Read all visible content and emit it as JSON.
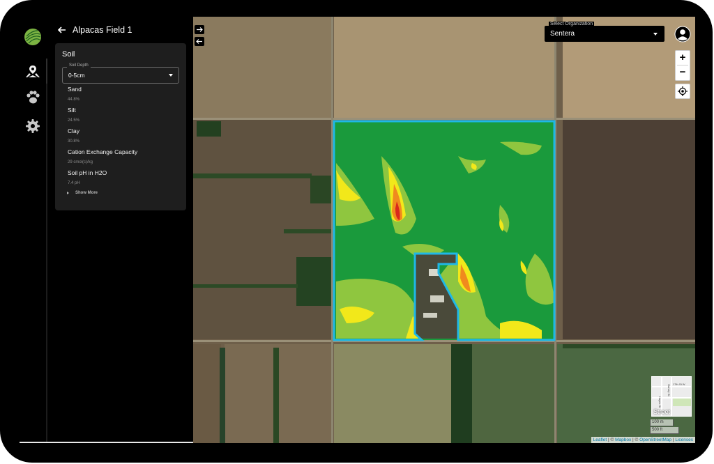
{
  "panel": {
    "back_label": "Alpacas Field 1",
    "card_title": "Soil",
    "soil_depth": {
      "label": "Soil Depth",
      "value": "0-5cm"
    },
    "properties": [
      {
        "name": "Sand",
        "value": "44.8%"
      },
      {
        "name": "Silt",
        "value": "24.5%"
      },
      {
        "name": "Clay",
        "value": "30.8%"
      },
      {
        "name": "Cation Exchange Capacity",
        "value": "29 cmol(c)/kg"
      },
      {
        "name": "Soil pH in H2O",
        "value": "7.4 pH"
      }
    ],
    "show_more": "Show More"
  },
  "nav": {
    "icons": [
      "logo-icon",
      "field-pin-icon",
      "paw-icon",
      "gear-icon"
    ]
  },
  "map": {
    "org_select": {
      "label": "Select Organization",
      "value": "Sentera"
    },
    "zoom_in": "+",
    "zoom_out": "−",
    "minimap": {
      "layer_label": "Street",
      "streets": [
        "17th St W",
        "Harvey St",
        "Hayes St"
      ]
    },
    "scale": {
      "metric": "100 m",
      "imperial": "500 ft"
    },
    "attribution": {
      "leaflet": "Leaflet",
      "sep1": " | © ",
      "mapbox": "Mapbox",
      "sep2": " | © ",
      "osm": "OpenStreetMap",
      "sep3": " | ",
      "licenses": "Licenses"
    },
    "colors": {
      "field_border": "#1fb8e6",
      "zone_green": "#1a9a3c",
      "zone_lightgreen": "#8fc63f",
      "zone_yellow": "#f2e81a",
      "zone_orange": "#f08a1e",
      "zone_red": "#d9281c"
    }
  }
}
